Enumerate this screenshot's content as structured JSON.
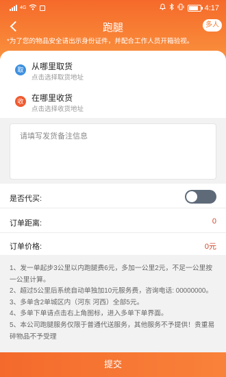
{
  "status_bar": {
    "network": "4G",
    "time": "4:17",
    "icons": [
      "signal-icon",
      "wifi-icon",
      "bell-icon",
      "bluetooth-icon",
      "vibrate-icon",
      "battery-icon"
    ]
  },
  "header": {
    "title": "跑腿",
    "multi_button": "多人",
    "notice": "*为了您的物品安全请出示身份证件，并配合工作人员开箱验视。"
  },
  "pickup": {
    "badge": "取",
    "title": "从哪里取货",
    "subtitle": "点击选择取货地址"
  },
  "delivery": {
    "badge": "收",
    "title": "在哪里收货",
    "subtitle": "点击选择收货地址"
  },
  "note": {
    "placeholder": "请填写发货备注信息",
    "value": ""
  },
  "form": {
    "purchase_label": "是否代买:",
    "purchase_toggle_on": false,
    "distance_label": "订单距离:",
    "distance_value": "0",
    "price_label": "订单价格:",
    "price_value": "0元"
  },
  "rules": [
    "1、发一单起步3公里以内跑腿费6元，多加一公里2元，不足一公里按一公里计算。",
    "2、超过5公里后系统自动单独加10元服务费，咨询电话: 00000000。",
    "3、多单含2单城区内（河东 河西）全部5元。",
    "4、多单下单请点击右上角图标，进入多单下单界面。",
    "5、本公司跑腿服务仅限于普通代送服务，其他服务不予提供！贵重易碎物品不予受理"
  ],
  "submit_label": "提交",
  "colors": {
    "accent": "#f57c2f",
    "price": "#d0452a",
    "pickup_badge": "#3d90e0",
    "delivery_badge": "#ef5a30"
  }
}
